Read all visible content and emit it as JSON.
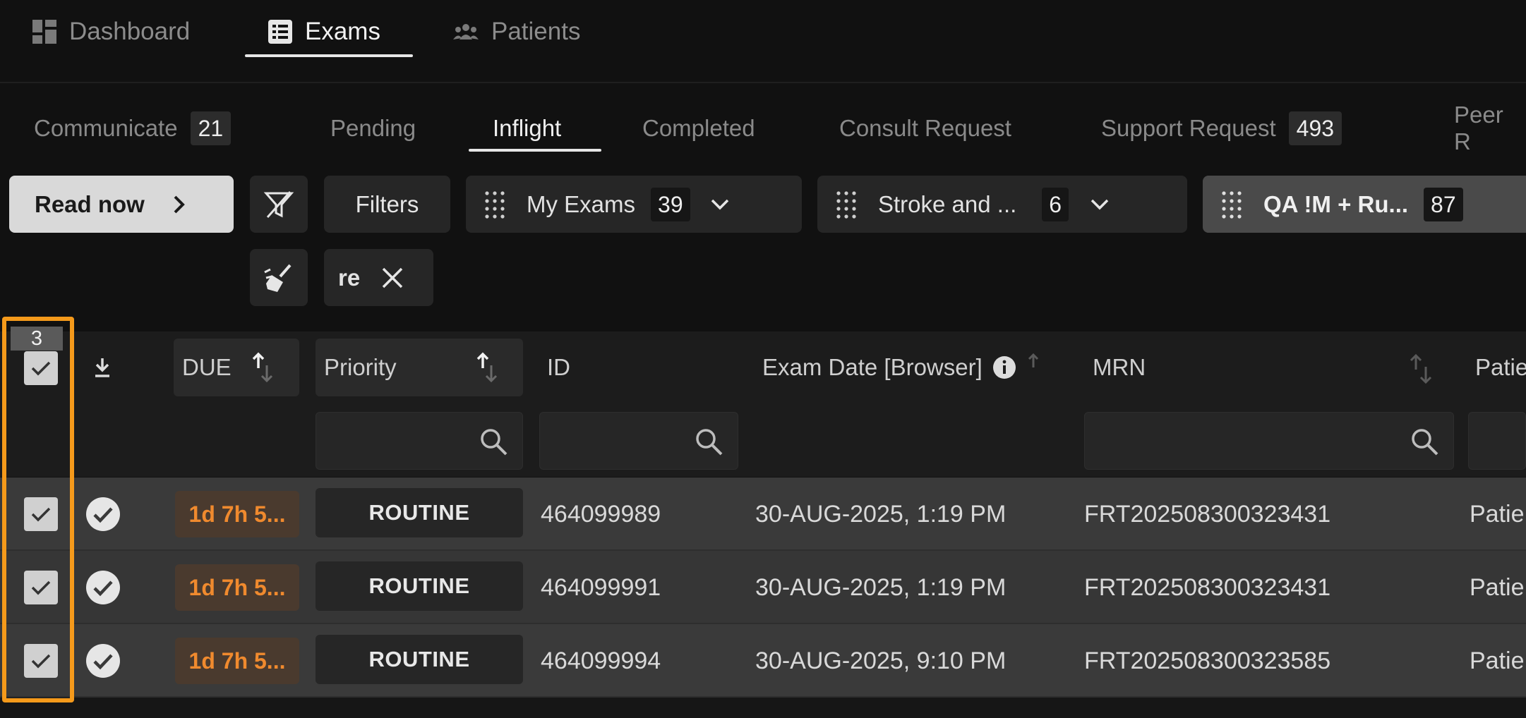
{
  "nav": {
    "tabs": [
      {
        "label": "Dashboard",
        "icon": "dashboard-icon"
      },
      {
        "label": "Exams",
        "icon": "list-icon"
      },
      {
        "label": "Patients",
        "icon": "people-icon"
      }
    ],
    "active": "Exams"
  },
  "subtabs": {
    "items": [
      {
        "label": "Communicate",
        "count": "21"
      },
      {
        "label": "Pending",
        "count": null
      },
      {
        "label": "Inflight",
        "count": null
      },
      {
        "label": "Completed",
        "count": null
      },
      {
        "label": "Consult Request",
        "count": null
      },
      {
        "label": "Support Request",
        "count": "493"
      },
      {
        "label": "Peer R",
        "count": null
      }
    ],
    "active": "Inflight"
  },
  "toolbar": {
    "read_now_label": "Read now",
    "filters_label": "Filters",
    "chips": [
      {
        "label": "My Exams",
        "count": "39"
      },
      {
        "label": "Stroke and ...",
        "count": "6"
      },
      {
        "label": "QA !M + Ru...",
        "count": "87"
      }
    ],
    "active_filter": "re"
  },
  "table": {
    "selected_count": "3",
    "columns": {
      "due": "DUE",
      "priority": "Priority",
      "id": "ID",
      "exam_date": "Exam Date [Browser]",
      "mrn": "MRN",
      "patient": "Patie"
    },
    "rows": [
      {
        "checked": true,
        "due": "1d 7h 5...",
        "priority": "ROUTINE",
        "id": "464099989",
        "exam_date": "30-AUG-2025, 1:19 PM",
        "mrn": "FRT202508300323431",
        "patient": "Patie"
      },
      {
        "checked": true,
        "due": "1d 7h 5...",
        "priority": "ROUTINE",
        "id": "464099991",
        "exam_date": "30-AUG-2025, 1:19 PM",
        "mrn": "FRT202508300323431",
        "patient": "Patie"
      },
      {
        "checked": true,
        "due": "1d 7h 5...",
        "priority": "ROUTINE",
        "id": "464099994",
        "exam_date": "30-AUG-2025, 9:10 PM",
        "mrn": "FRT202508300323585",
        "patient": "Patie"
      }
    ]
  },
  "colors": {
    "accent_highlight": "#f59a1b",
    "due_text": "#f08a2e",
    "background": "#111111"
  }
}
